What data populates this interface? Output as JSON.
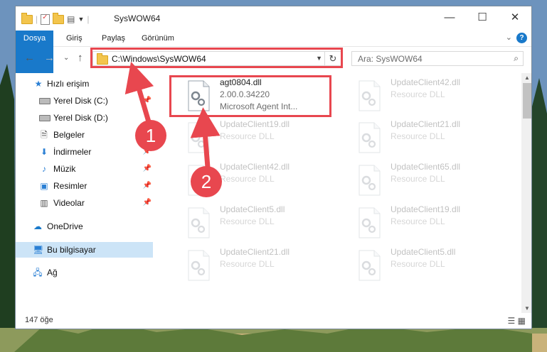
{
  "window": {
    "title": "SysWOW64",
    "minimize_glyph": "—",
    "maximize_glyph": "☐",
    "close_glyph": "✕"
  },
  "ribbon": {
    "tabs": [
      "Dosya",
      "Giriş",
      "Paylaş",
      "Görünüm"
    ],
    "expand_glyph": "⌄",
    "help_glyph": "?"
  },
  "nav": {
    "back_glyph": "←",
    "forward_glyph": "→",
    "recent_glyph": "⌄",
    "up_glyph": "↑",
    "address": "C:\\Windows\\SysWOW64",
    "search_placeholder": "Ara: SysWOW64"
  },
  "sidebar": {
    "items": [
      {
        "label": "Hızlı erişim",
        "icon": "star-icon"
      },
      {
        "label": "Yerel Disk (C:)",
        "icon": "disk-icon"
      },
      {
        "label": "Yerel Disk (D:)",
        "icon": "disk-icon"
      },
      {
        "label": "Belgeler",
        "icon": "documents-icon"
      },
      {
        "label": "İndirmeler",
        "icon": "download-icon"
      },
      {
        "label": "Müzik",
        "icon": "music-icon"
      },
      {
        "label": "Resimler",
        "icon": "pictures-icon"
      },
      {
        "label": "Videolar",
        "icon": "videos-icon"
      },
      {
        "label": "OneDrive",
        "icon": "cloud-icon"
      },
      {
        "label": "Bu bilgisayar",
        "icon": "computer-icon"
      },
      {
        "label": "Ağ",
        "icon": "network-icon"
      }
    ]
  },
  "files": [
    {
      "name": "agt0804.dll",
      "line1": "2.00.0.34220",
      "line2": "Microsoft Agent Int..."
    },
    {
      "name": "UpdateClient42.dll",
      "line1": "Resource DLL",
      "line2": ""
    },
    {
      "name": "UpdateClient19.dll",
      "line1": "Resource DLL",
      "line2": ""
    },
    {
      "name": "UpdateClient21.dll",
      "line1": "Resource DLL",
      "line2": ""
    },
    {
      "name": "UpdateClient42.dll",
      "line1": "Resource DLL",
      "line2": ""
    },
    {
      "name": "UpdateClient65.dll",
      "line1": "Resource DLL",
      "line2": ""
    },
    {
      "name": "UpdateClient5.dll",
      "line1": "Resource DLL",
      "line2": ""
    },
    {
      "name": "UpdateClient19.dll",
      "line1": "Resource DLL",
      "line2": ""
    },
    {
      "name": "UpdateClient21.dll",
      "line1": "Resource DLL",
      "line2": ""
    },
    {
      "name": "UpdateClient5.dll",
      "line1": "Resource DLL",
      "line2": ""
    }
  ],
  "status": {
    "count": "147 öğe"
  },
  "annotations": {
    "badge1": "1",
    "badge2": "2",
    "color": "#e8474f"
  }
}
